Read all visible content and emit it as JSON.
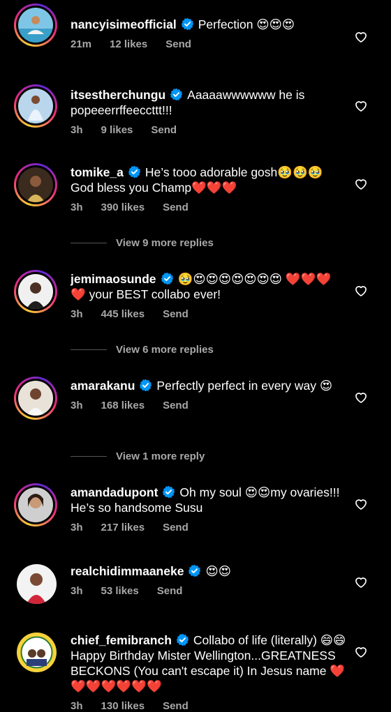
{
  "comments": [
    {
      "username": "nancyisimeofficial",
      "text": "Perfection 😍😍😍",
      "time": "21m",
      "likes": "12 likes",
      "reply": "Send"
    },
    {
      "username": "itsestherchungu",
      "text": "Aaaaawwwwww he is popeeerrffeeccttt!!!",
      "time": "3h",
      "likes": "9 likes",
      "reply": "Send"
    },
    {
      "username": "tomike_a",
      "text": "He’s tooo adorable gosh🥹🥹🥹 God bless you Champ❤️❤️❤️",
      "time": "3h",
      "likes": "390 likes",
      "reply": "Send",
      "more_replies": "View 9 more replies"
    },
    {
      "username": "jemimaosunde",
      "text": "🥹😍😍😍😍😍😍😍 ❤️❤️❤️❤️ your BEST collabo ever!",
      "time": "3h",
      "likes": "445 likes",
      "reply": "Send",
      "more_replies": "View 6 more replies"
    },
    {
      "username": "amarakanu",
      "text": "Perfectly perfect in every way 😍",
      "time": "3h",
      "likes": "168 likes",
      "reply": "Send",
      "more_replies": "View 1 more reply"
    },
    {
      "username": "amandadupont",
      "text": "Oh my soul 😍😍my ovaries!!! He’s so handsome Susu",
      "time": "3h",
      "likes": "217 likes",
      "reply": "Send"
    },
    {
      "username": "realchidimmaaneke",
      "text": "😍😍",
      "time": "3h",
      "likes": "53 likes",
      "reply": "Send"
    },
    {
      "username": "chief_femibranch",
      "text": "Collabo of life (literally) 😄😄 Happy Birthday Mister Wellington...GREATNESS BECKONS (You can't escape it) In Jesus name ❤️❤️❤️❤️❤️❤️❤️",
      "time": "3h",
      "likes": "130 likes",
      "reply": "Send"
    }
  ],
  "colors": {
    "background": "#000000",
    "verified": "#0095f6",
    "meta": "#a8a8a8"
  },
  "icons": {
    "verified": "verified-badge-icon",
    "like": "heart-outline-icon"
  }
}
